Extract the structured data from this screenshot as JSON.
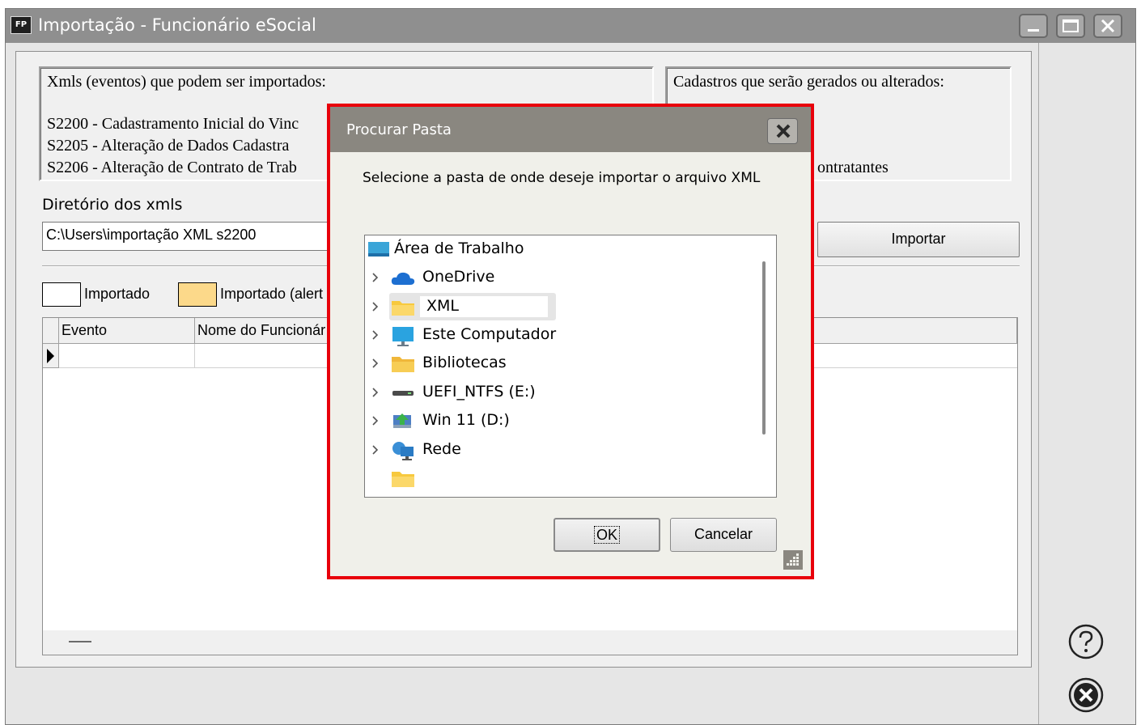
{
  "window": {
    "title": "Importação - Funcionário eSocial",
    "icon_label": "FP"
  },
  "events_panel": {
    "heading": "Xmls (eventos) que podem ser importados:",
    "items": [
      "S2200 - Cadastramento Inicial do Vinc",
      "S2205 - Alteração de Dados Cadastra",
      "S2206 - Alteração de Contrato de Trab"
    ]
  },
  "records_panel": {
    "heading": "Cadastros que serão gerados ou alterados:",
    "visible_fragment": "ontratantes"
  },
  "directory": {
    "label": "Diretório dos xmls",
    "value": "C:\\Users\\importação XML s2200"
  },
  "import_button": "Importar",
  "legend": {
    "imported": "Importado",
    "imported_alert": "Importado (alert"
  },
  "grid": {
    "columns": [
      "Evento",
      "Nome do Funcionár"
    ]
  },
  "dialog": {
    "title": "Procurar Pasta",
    "prompt": "Selecione a pasta de onde deseje importar o arquivo XML",
    "tree": {
      "root": "Área de Trabalho",
      "items": [
        {
          "label": "OneDrive",
          "icon": "cloud-icon"
        },
        {
          "label": "XML",
          "icon": "folder-icon"
        },
        {
          "label": "Este Computador",
          "icon": "monitor-icon"
        },
        {
          "label": "Bibliotecas",
          "icon": "library-icon"
        },
        {
          "label": "UEFI_NTFS (E:)",
          "icon": "drive-icon"
        },
        {
          "label": "Win 11 (D:)",
          "icon": "disk-icon"
        },
        {
          "label": "Rede",
          "icon": "network-icon"
        },
        {
          "label": "",
          "icon": "folder-icon"
        }
      ]
    },
    "ok_button": "OK",
    "cancel_button": "Cancelar"
  },
  "colors": {
    "dialog_highlight": "#e8000b",
    "titlebar": "#8f8f8f",
    "legend_alert": "#fcd98a"
  }
}
